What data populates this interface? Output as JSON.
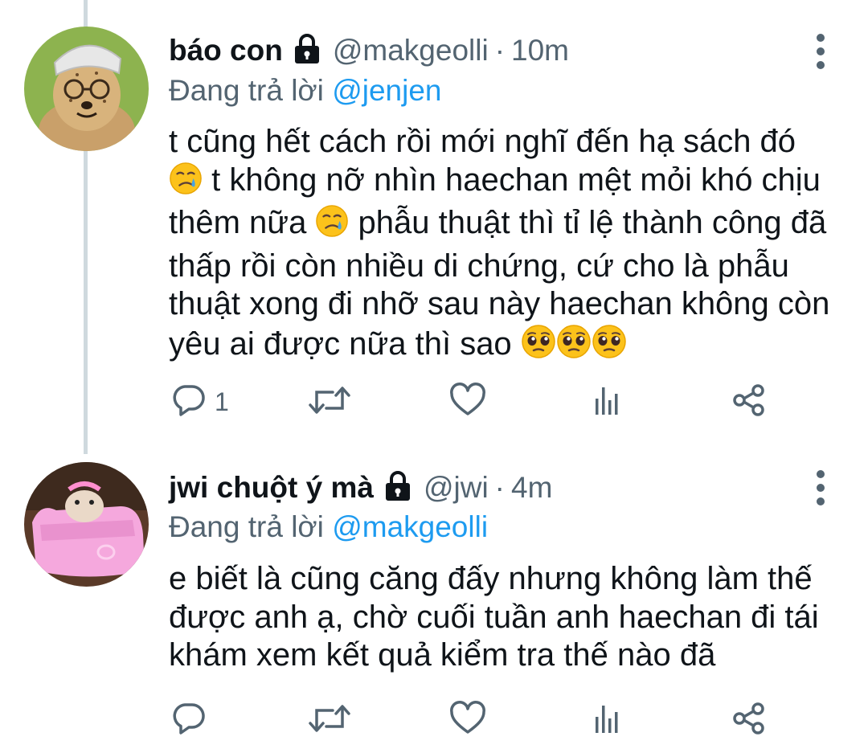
{
  "tweets": [
    {
      "display_name": "báo con",
      "handle": "@makgeolli",
      "separator": "·",
      "time": "10m",
      "reply_prefix": "Đang trả lời",
      "reply_to": "@jenjen",
      "body": {
        "p1": "t cũng hết cách rồi mới nghĩ đến hạ sách đó ",
        "p2": " t không nỡ nhìn haechan mệt mỏi khó chịu thêm nữa ",
        "p3": " phẫu thuật thì tỉ lệ thành công đã thấp rồi còn nhiều di chứng, cứ cho là phẫu thuật xong đi nhỡ sau này haechan không còn yêu ai được nữa thì sao "
      },
      "reply_count": "1"
    },
    {
      "display_name": "jwi chuột ý mà",
      "handle": "@jwi",
      "separator": "·",
      "time": "4m",
      "reply_prefix": "Đang trả lời",
      "reply_to": "@makgeolli",
      "body": {
        "p1": "e biết là cũng căng đấy nhưng không làm thế được anh ạ, chờ cuối tuần anh haechan đi tái khám xem kết quả kiểm tra thế nào đã"
      }
    }
  ],
  "colors": {
    "text": "#0f1419",
    "secondary": "#536471",
    "link": "#1d9bf0",
    "thread_line": "#cfd9de"
  },
  "icons": [
    "lock-icon",
    "more-icon",
    "reply-icon",
    "retweet-icon",
    "like-icon",
    "views-icon",
    "share-icon",
    "sad-tear-emoji",
    "pleading-face-emoji"
  ]
}
